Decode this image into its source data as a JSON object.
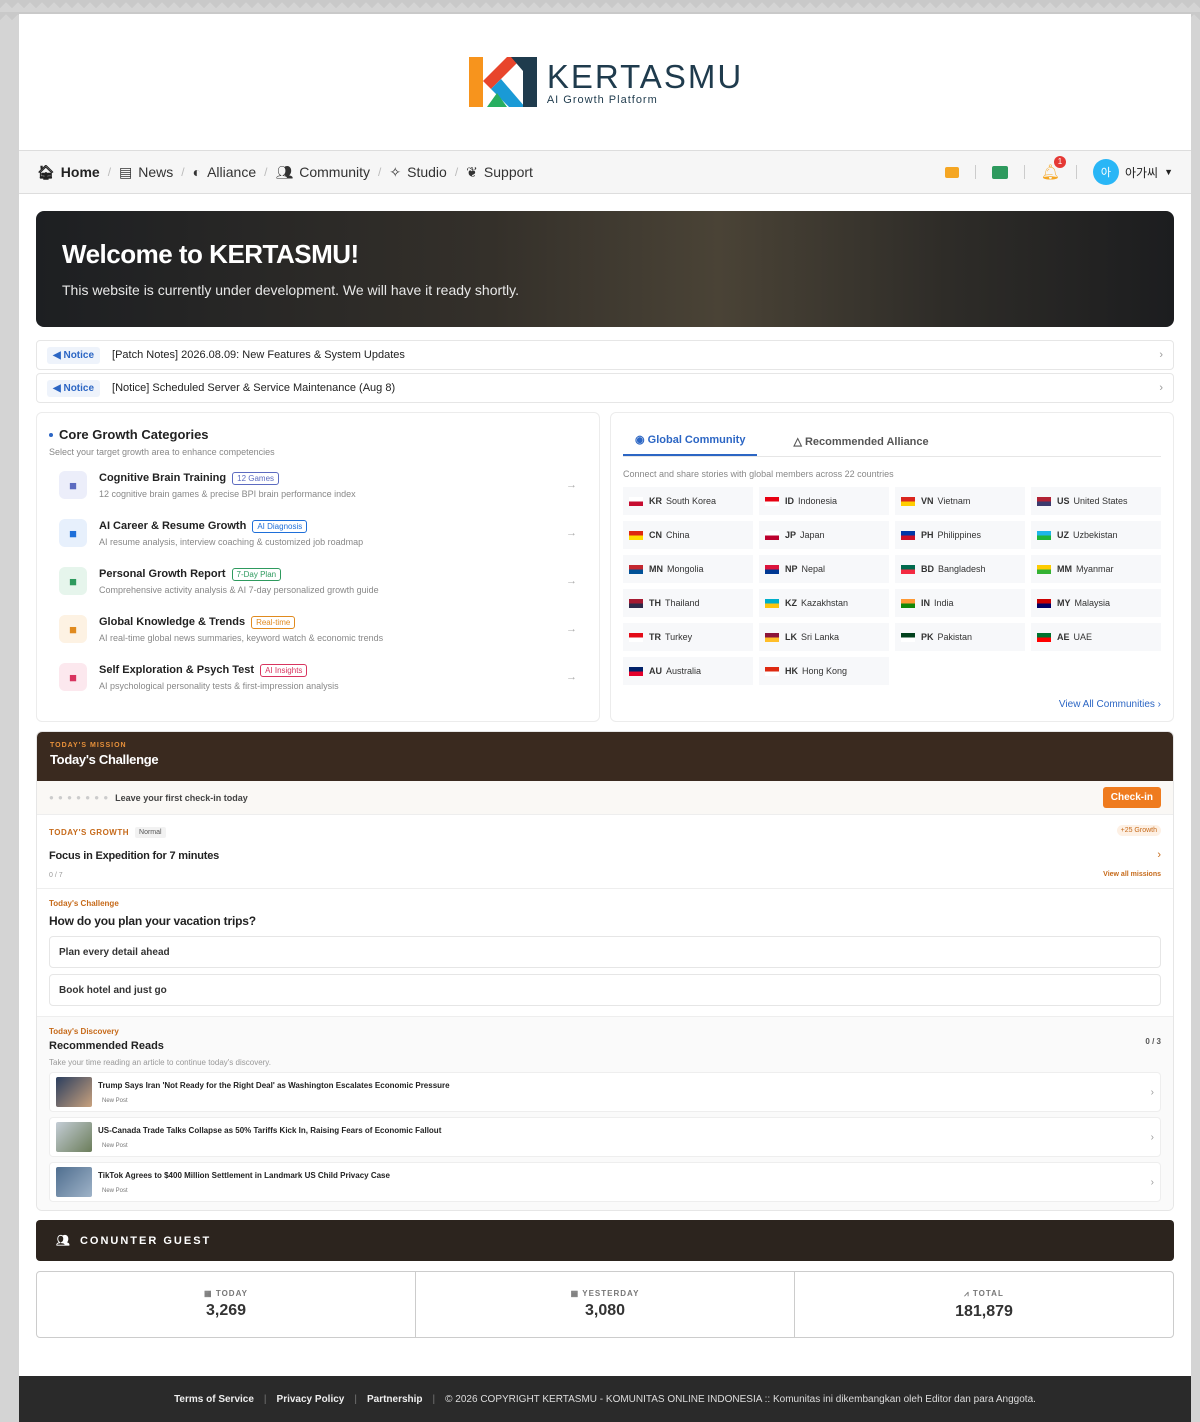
{
  "brand": {
    "name": "KERTASMU",
    "tagline": "AI Growth Platform"
  },
  "nav": {
    "items": [
      {
        "label": "Home",
        "icon": "home-icon"
      },
      {
        "label": "News",
        "icon": "news-icon"
      },
      {
        "label": "Alliance",
        "icon": "shield-icon"
      },
      {
        "label": "Community",
        "icon": "users-icon"
      },
      {
        "label": "Studio",
        "icon": "wand-icon"
      },
      {
        "label": "Support",
        "icon": "sprout-icon"
      }
    ],
    "notification_count": "1",
    "avatar_initial": "아",
    "user_name": "아가씨"
  },
  "hero": {
    "title": "Welcome to KERTASMU!",
    "subtitle": "This website is currently under development. We will have it ready shortly."
  },
  "notices": [
    {
      "tag": "Notice",
      "text": "[Patch Notes] 2026.08.09: New Features & System Updates"
    },
    {
      "tag": "Notice",
      "text": "[Notice] Scheduled Server & Service Maintenance (Aug 8)"
    }
  ],
  "categories": {
    "title": "Core Growth Categories",
    "subtitle": "Select your target growth area to enhance competencies",
    "items": [
      {
        "title": "Cognitive Brain Training",
        "pill": "12 Games",
        "desc": "12 cognitive brain games & precise BPI brain performance index",
        "color": "#5c6bc0",
        "bg": "#eceefa"
      },
      {
        "title": "AI Career & Resume Growth",
        "pill": "AI Diagnosis",
        "desc": "AI resume analysis, interview coaching & customized job roadmap",
        "color": "#1e6fd9",
        "bg": "#e7f0fc"
      },
      {
        "title": "Personal Growth Report",
        "pill": "7-Day Plan",
        "desc": "Comprehensive activity analysis & AI 7-day personalized growth guide",
        "color": "#2e9a5e",
        "bg": "#e6f5ec"
      },
      {
        "title": "Global Knowledge & Trends",
        "pill": "Real-time",
        "desc": "AI real-time global news summaries, keyword watch & economic trends",
        "color": "#e08a1e",
        "bg": "#fdf2e3"
      },
      {
        "title": "Self Exploration & Psych Test",
        "pill": "AI Insights",
        "desc": "AI psychological personality tests & first-impression analysis",
        "color": "#d8345f",
        "bg": "#fce8ee"
      }
    ]
  },
  "community": {
    "tabs": [
      "Global Community",
      "Recommended Alliance"
    ],
    "subtitle": "Connect and share stories with global members across 22 countries",
    "countries": [
      {
        "code": "KR",
        "name": "South Korea",
        "c1": "#ffffff",
        "c2": "#c60c30"
      },
      {
        "code": "ID",
        "name": "Indonesia",
        "c1": "#e70011",
        "c2": "#ffffff"
      },
      {
        "code": "VN",
        "name": "Vietnam",
        "c1": "#da251d",
        "c2": "#ffcd00"
      },
      {
        "code": "US",
        "name": "United States",
        "c1": "#b22234",
        "c2": "#3c3b6e"
      },
      {
        "code": "CN",
        "name": "China",
        "c1": "#de2910",
        "c2": "#ffde00"
      },
      {
        "code": "JP",
        "name": "Japan",
        "c1": "#ffffff",
        "c2": "#bc002d"
      },
      {
        "code": "PH",
        "name": "Philippines",
        "c1": "#0038a8",
        "c2": "#ce1126"
      },
      {
        "code": "UZ",
        "name": "Uzbekistan",
        "c1": "#1eb5e8",
        "c2": "#1eb53a"
      },
      {
        "code": "MN",
        "name": "Mongolia",
        "c1": "#c4272f",
        "c2": "#015197"
      },
      {
        "code": "NP",
        "name": "Nepal",
        "c1": "#dc143c",
        "c2": "#003893"
      },
      {
        "code": "BD",
        "name": "Bangladesh",
        "c1": "#006a4e",
        "c2": "#f42a41"
      },
      {
        "code": "MM",
        "name": "Myanmar",
        "c1": "#fecb00",
        "c2": "#34b233"
      },
      {
        "code": "TH",
        "name": "Thailand",
        "c1": "#a51931",
        "c2": "#2d2a4a"
      },
      {
        "code": "KZ",
        "name": "Kazakhstan",
        "c1": "#00afca",
        "c2": "#fec50c"
      },
      {
        "code": "IN",
        "name": "India",
        "c1": "#ff9933",
        "c2": "#138808"
      },
      {
        "code": "MY",
        "name": "Malaysia",
        "c1": "#cc0001",
        "c2": "#010066"
      },
      {
        "code": "TR",
        "name": "Turkey",
        "c1": "#e30a17",
        "c2": "#ffffff"
      },
      {
        "code": "LK",
        "name": "Sri Lanka",
        "c1": "#8d153a",
        "c2": "#ffbe29"
      },
      {
        "code": "PK",
        "name": "Pakistan",
        "c1": "#01411c",
        "c2": "#ffffff"
      },
      {
        "code": "AE",
        "name": "UAE",
        "c1": "#00732f",
        "c2": "#ff0000"
      },
      {
        "code": "AU",
        "name": "Australia",
        "c1": "#012169",
        "c2": "#e4002b"
      },
      {
        "code": "HK",
        "name": "Hong Kong",
        "c1": "#de2910",
        "c2": "#ffffff"
      }
    ],
    "view_all": "View All Communities"
  },
  "mission": {
    "kicker": "TODAY'S MISSION",
    "title": "Today's Challenge",
    "checkin_text": "Leave your first check-in today",
    "checkin_button": "Check-in",
    "growth_kicker": "TODAY'S GROWTH",
    "growth_level": "Normal",
    "growth_reward": "+25 Growth",
    "growth_title": "Focus in Expedition for 7 minutes",
    "growth_progress": "0 / 7",
    "view_all": "View all missions",
    "challenge_kicker": "Today's Challenge",
    "question": "How do you plan your vacation trips?",
    "options": [
      "Plan every detail ahead",
      "Book hotel and just go"
    ],
    "discovery_kicker": "Today's Discovery",
    "discovery_title": "Recommended Reads",
    "discovery_sub": "Take your time reading an article to continue today's discovery.",
    "discovery_count": "0 / 3",
    "reads": [
      {
        "title": "Trump Says Iran 'Not Ready for the Right Deal' as Washington Escalates Economic Pressure",
        "tag": "New Post",
        "c1": "#2b3e5e",
        "c2": "#c9a27e"
      },
      {
        "title": "US-Canada Trade Talks Collapse as 50% Tariffs Kick In, Raising Fears of Economic Fallout",
        "tag": "New Post",
        "c1": "#c4cdd6",
        "c2": "#6b7d5a"
      },
      {
        "title": "TikTok Agrees to $400 Million Settlement in Landmark US Child Privacy Case",
        "tag": "New Post",
        "c1": "#4f6e8f",
        "c2": "#9fb3c8"
      }
    ]
  },
  "counter": {
    "title": "CONUNTER GUEST",
    "boxes": [
      {
        "label": "TODAY",
        "value": "3,269"
      },
      {
        "label": "YESTERDAY",
        "value": "3,080"
      },
      {
        "label": "TOTAL",
        "value": "181,879"
      }
    ]
  },
  "footer": {
    "links": [
      "Terms of Service",
      "Privacy Policy",
      "Partnership"
    ],
    "copyright": "© 2026 COPYRIGHT KERTASMU - KOMUNITAS ONLINE INDONESIA :: Komunitas ini dikembangkan oleh Editor dan para Anggota."
  }
}
